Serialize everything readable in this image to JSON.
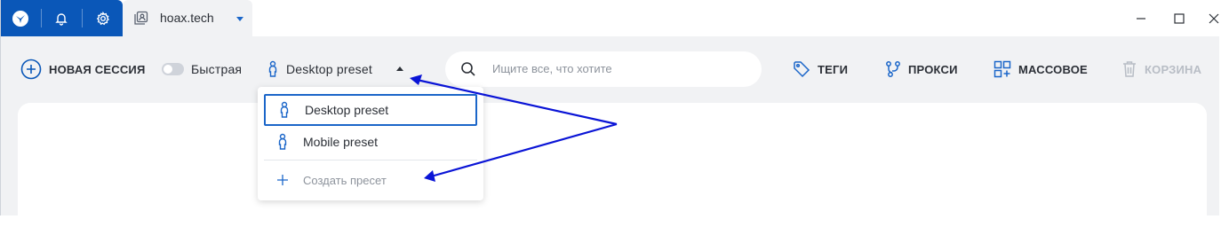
{
  "titlebar": {
    "tab_title": "hoax.tech"
  },
  "toolbar": {
    "new_session_label": "НОВАЯ СЕССИЯ",
    "quick_label": "Быстрая",
    "preset_label": "Desktop preset",
    "search_placeholder": "Ищите все, что хотите",
    "tags_label": "ТЕГИ",
    "proxy_label": "ПРОКСИ",
    "bulk_label": "МАССОВОЕ",
    "trash_label": "КОРЗИНА"
  },
  "dropdown": {
    "items": [
      {
        "label": "Desktop preset",
        "selected": true
      },
      {
        "label": "Mobile preset",
        "selected": false
      }
    ],
    "create_label": "Создать пресет"
  },
  "colors": {
    "accent": "#0a57b8",
    "annotation_arrow": "#0a14d6",
    "disabled": "#b8bdc5"
  }
}
